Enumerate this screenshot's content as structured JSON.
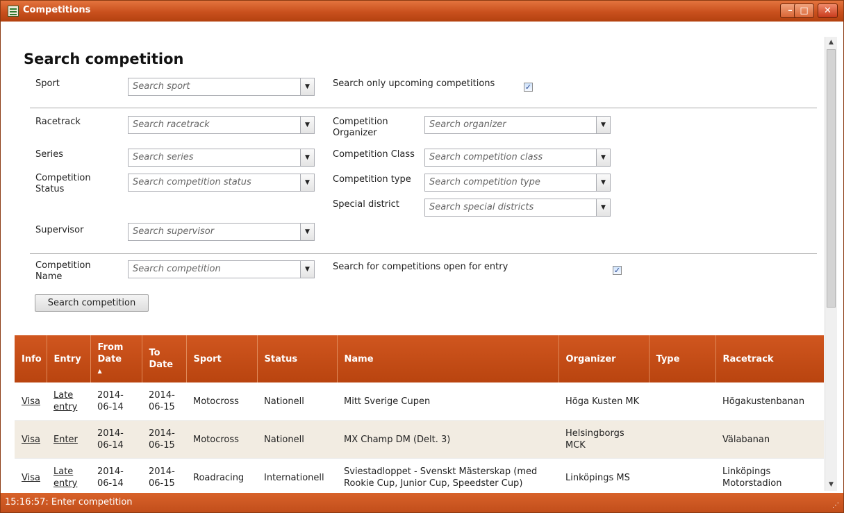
{
  "window": {
    "title": "Competitions"
  },
  "heading": "Search competition",
  "filters": {
    "sport": {
      "label": "Sport",
      "placeholder": "Search sport"
    },
    "upcoming": {
      "label": "Search only upcoming competitions",
      "checked": true
    },
    "racetrack": {
      "label": "Racetrack",
      "placeholder": "Search racetrack"
    },
    "organizer": {
      "label": "Competition Organizer",
      "placeholder": "Search organizer"
    },
    "series": {
      "label": "Series",
      "placeholder": "Search series"
    },
    "comp_class": {
      "label": "Competition Class",
      "placeholder": "Search competition class"
    },
    "status": {
      "label": "Competition Status",
      "placeholder": "Search competition status"
    },
    "comp_type": {
      "label": "Competition type",
      "placeholder": "Search competition type"
    },
    "district": {
      "label": "Special district",
      "placeholder": "Search special districts"
    },
    "supervisor": {
      "label": "Supervisor",
      "placeholder": "Search supervisor"
    },
    "name": {
      "label": "Competition Name",
      "placeholder": "Search competition"
    },
    "open_entry": {
      "label": "Search for competitions open for entry",
      "checked": true
    }
  },
  "search_button": "Search competition",
  "table": {
    "columns": [
      "Info",
      "Entry",
      "From Date",
      "To Date",
      "Sport",
      "Status",
      "Name",
      "Organizer",
      "Type",
      "Racetrack"
    ],
    "sorted_column": "From Date",
    "sort_direction": "ascending",
    "rows": [
      {
        "info": "Visa",
        "entry": "Late entry",
        "from": "2014-06-14",
        "to": "2014-06-15",
        "sport": "Motocross",
        "status": "Nationell",
        "name": "Mitt Sverige Cupen",
        "organizer": "Höga Kusten MK",
        "type": "",
        "racetrack": "Högakustenbanan"
      },
      {
        "info": "Visa",
        "entry": "Enter",
        "from": "2014-06-14",
        "to": "2014-06-15",
        "sport": "Motocross",
        "status": "Nationell",
        "name": "MX Champ DM (Delt. 3)",
        "organizer": "Helsingborgs MCK",
        "type": "",
        "racetrack": "Välabanan"
      },
      {
        "info": "Visa",
        "entry": "Late entry",
        "from": "2014-06-14",
        "to": "2014-06-15",
        "sport": "Roadracing",
        "status": "Internationell",
        "name": "Sviestadloppet - Svenskt Mästerskap (med Rookie Cup, Junior Cup, Speedster Cup)",
        "organizer": "Linköpings MS",
        "type": "",
        "racetrack": "Linköpings Motorstadion"
      }
    ]
  },
  "status_bar": "15:16:57: Enter competition",
  "colors": {
    "title_bar": "#c9501d",
    "header": "#c24e1b",
    "alt_row": "#f2ece2"
  },
  "icons": {
    "app": "list-window-icon",
    "minimize": "minimize-icon",
    "maximize": "maximize-icon",
    "close": "close-icon",
    "dropdown": "chevron-down-icon",
    "grip": "resize-grip-icon"
  }
}
